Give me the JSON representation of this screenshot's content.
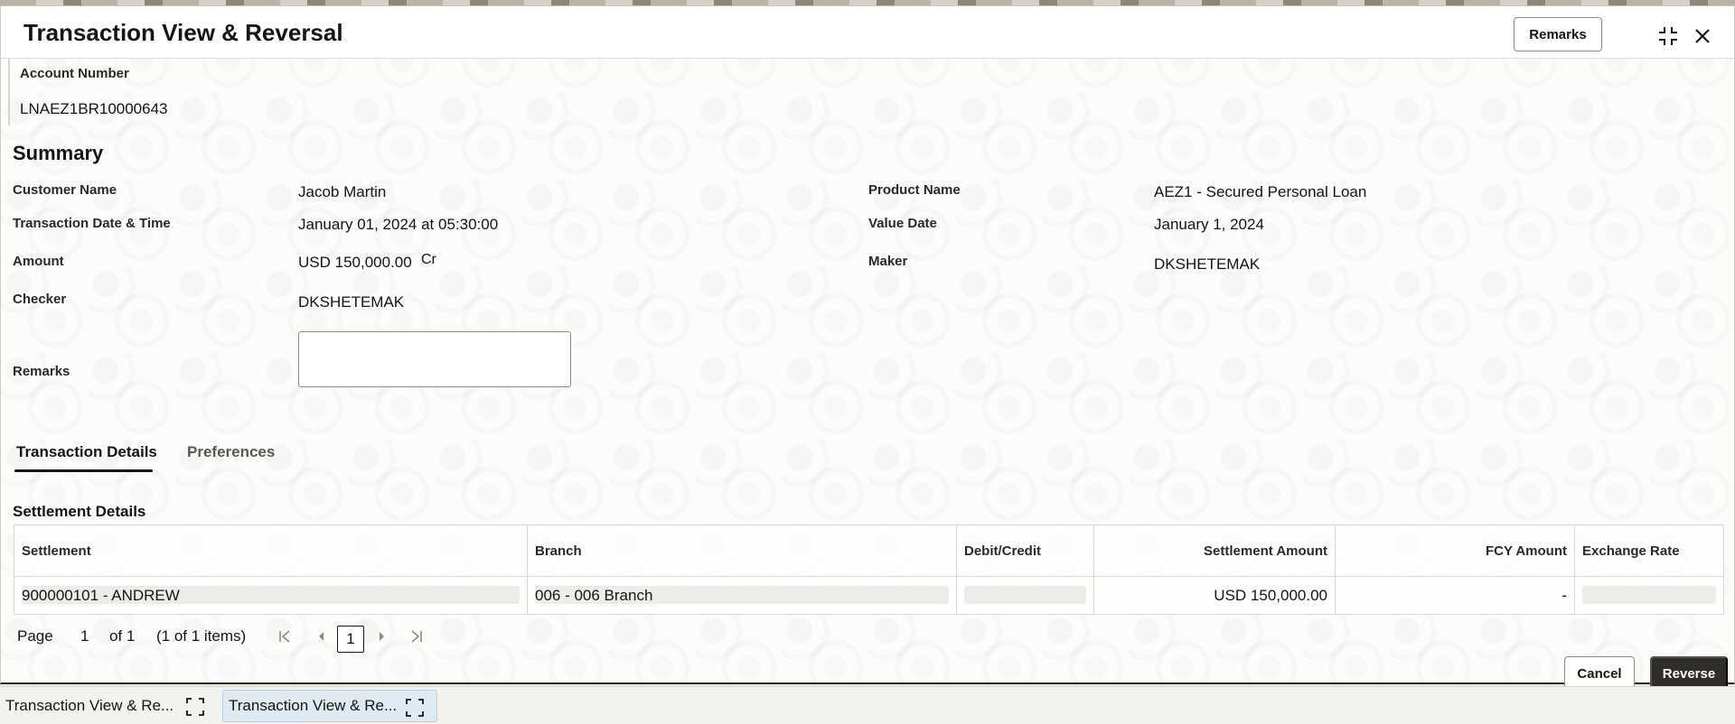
{
  "dialog": {
    "title": "Transaction View & Reversal",
    "remarks_button": "Remarks"
  },
  "account": {
    "label": "Account Number",
    "value": "LNAEZ1BR10000643"
  },
  "summary": {
    "title": "Summary",
    "customer_name_label": "Customer Name",
    "customer_name": "Jacob Martin",
    "product_name_label": "Product Name",
    "product_name": "AEZ1 - Secured Personal Loan",
    "txn_datetime_label": "Transaction Date & Time",
    "txn_datetime": "January 01, 2024 at 05:30:00",
    "value_date_label": "Value Date",
    "value_date": "January 1, 2024",
    "amount_label": "Amount",
    "amount": "USD 150,000.00",
    "amount_type": "Cr",
    "maker_label": "Maker",
    "maker": "DKSHETEMAK",
    "checker_label": "Checker",
    "checker": "DKSHETEMAK",
    "remarks_label": "Remarks",
    "remarks_value": ""
  },
  "tabs": [
    {
      "label": "Transaction Details",
      "active": true
    },
    {
      "label": "Preferences",
      "active": false
    }
  ],
  "settlement": {
    "title": "Settlement Details",
    "columns": [
      "Settlement",
      "Branch",
      "Debit/Credit",
      "Settlement Amount",
      "FCY Amount",
      "Exchange Rate"
    ],
    "rows": [
      {
        "settlement": "900000101 - ANDREW",
        "branch": "006 - 006 Branch",
        "debit_credit": "",
        "settlement_amount": "USD 150,000.00",
        "fcy_amount": "-",
        "exchange_rate": ""
      }
    ]
  },
  "pager": {
    "page_label": "Page",
    "page_value": "1",
    "of_label": "of 1",
    "items_label": "(1 of 1 items)",
    "current": "1"
  },
  "footer": {
    "cancel": "Cancel",
    "reverse": "Reverse"
  },
  "taskbar": [
    {
      "label": "Transaction View & Re..."
    },
    {
      "label": "Transaction View & Re..."
    }
  ]
}
